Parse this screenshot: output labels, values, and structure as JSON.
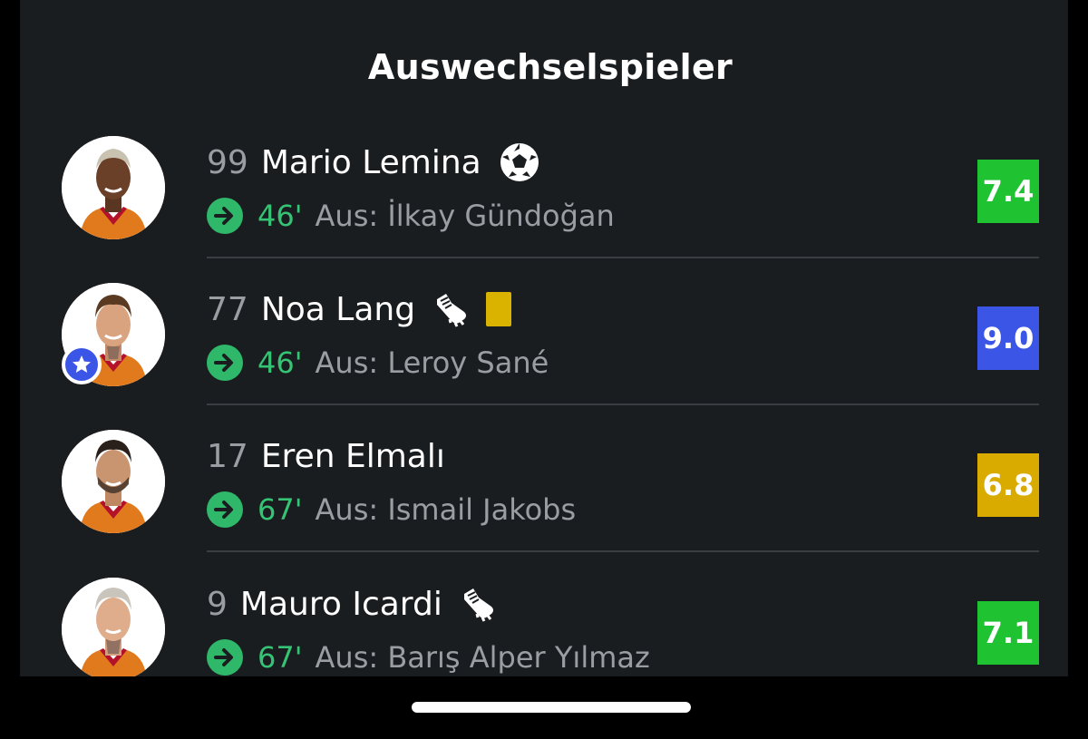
{
  "title": "Auswechselspieler",
  "players": [
    {
      "number": "99",
      "name": "Mario Lemina",
      "events": [
        "ball-icon"
      ],
      "minute": "46'",
      "out": "Aus: İlkay Gündoğan",
      "rating": "7.4",
      "rating_color": "#1fc331",
      "star": false
    },
    {
      "number": "77",
      "name": "Noa Lang",
      "events": [
        "boot-icon",
        "yellow-card"
      ],
      "minute": "46'",
      "out": "Aus: Leroy Sané",
      "rating": "9.0",
      "rating_color": "#3b55e6",
      "star": true
    },
    {
      "number": "17",
      "name": "Eren Elmalı",
      "events": [],
      "minute": "67'",
      "out": "Aus: Ismail Jakobs",
      "rating": "6.8",
      "rating_color": "#d9ab00",
      "star": false
    },
    {
      "number": "9",
      "name": "Mauro Icardi",
      "events": [
        "boot-icon"
      ],
      "minute": "67'",
      "out": "Aus: Barış Alper Yılmaz",
      "rating": "7.1",
      "rating_color": "#1fc331",
      "star": false
    }
  ],
  "colors": {
    "background": "#1a1d20",
    "sub_green": "#35c374",
    "yellow_card": "#d9b300"
  }
}
